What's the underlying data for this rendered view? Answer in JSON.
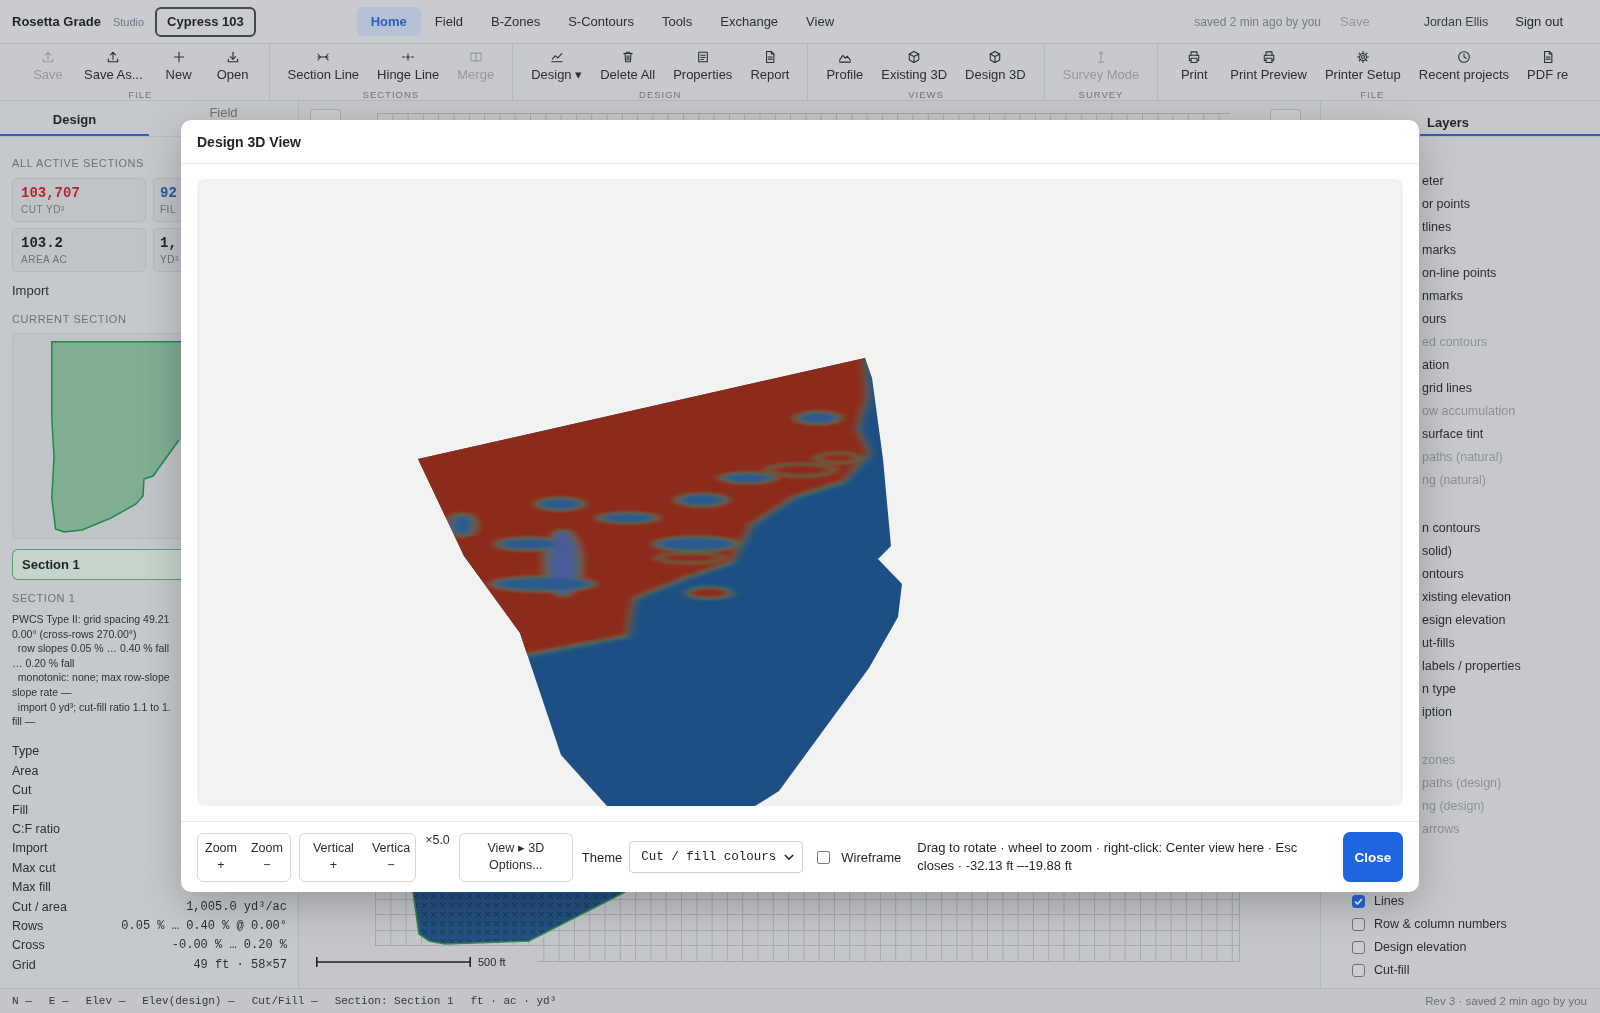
{
  "app": {
    "name": "Rosetta Grade",
    "edition": "Studio",
    "project": "Cypress 103"
  },
  "nav": [
    {
      "label": "Home",
      "selected": true
    },
    {
      "label": "Field",
      "selected": false
    },
    {
      "label": "B-Zones",
      "selected": false
    },
    {
      "label": "S-Contours",
      "selected": false
    },
    {
      "label": "Tools",
      "selected": false
    },
    {
      "label": "Exchange",
      "selected": false
    },
    {
      "label": "View",
      "selected": false
    }
  ],
  "session": {
    "status": "saved 2 min ago by you",
    "save": {
      "label": "Save",
      "disabled": true
    },
    "user": "Jordan Ellis",
    "sign_out": "Sign out"
  },
  "toolbar": [
    {
      "label": "FILE",
      "buttons": [
        {
          "label": "Save",
          "disabled": true
        },
        {
          "label": "Save As...",
          "disabled": false
        },
        {
          "label": "New",
          "disabled": false
        },
        {
          "label": "Open",
          "disabled": false
        }
      ]
    },
    {
      "label": "SECTIONS",
      "buttons": [
        {
          "label": "Section Line",
          "disabled": false
        },
        {
          "label": "Hinge Line",
          "disabled": false
        },
        {
          "label": "Merge",
          "disabled": true
        }
      ]
    },
    {
      "label": "DESIGN",
      "buttons": [
        {
          "label": "Design ▾",
          "disabled": false
        },
        {
          "label": "Delete All",
          "disabled": false
        },
        {
          "label": "Properties",
          "disabled": false
        },
        {
          "label": "Report",
          "disabled": false
        }
      ]
    },
    {
      "label": "VIEWS",
      "buttons": [
        {
          "label": "Profile",
          "disabled": false
        },
        {
          "label": "Existing 3D",
          "disabled": false
        },
        {
          "label": "Design 3D",
          "disabled": false
        }
      ]
    },
    {
      "label": "SURVEY",
      "buttons": [
        {
          "label": "Survey Mode",
          "disabled": true
        }
      ]
    },
    {
      "label": "FILE",
      "buttons": [
        {
          "label": "Print",
          "disabled": false
        },
        {
          "label": "Print Preview",
          "disabled": false
        },
        {
          "label": "Printer Setup",
          "disabled": false
        },
        {
          "label": "Recent projects",
          "disabled": false
        },
        {
          "label": "PDF re",
          "disabled": false
        }
      ]
    }
  ],
  "left_panel": {
    "tabs": [
      {
        "label": "Design",
        "selected": true
      },
      {
        "label": "Field",
        "selected": false
      }
    ],
    "totals_heading": "ALL ACTIVE SECTIONS",
    "totals": [
      {
        "value": "103,707",
        "label": "CUT YD³",
        "color": "#b3262d"
      },
      {
        "value": "92",
        "label": "FIL",
        "color": "#28589a"
      },
      {
        "value": "103.2",
        "label": "AREA AC",
        "color": "#1f2227"
      },
      {
        "value": "1,",
        "label": "YD³",
        "color": "#1f2227"
      }
    ],
    "import": "Import",
    "current_heading": "CURRENT SECTION",
    "sections": [
      {
        "label": "Section 1",
        "selected": true
      }
    ],
    "section_heading": "SECTION 1",
    "description_lines": [
      "PWCS Type II: grid spacing 49.21",
      "0.00° (cross-rows 270.00°)",
      "  row slopes 0.05 % … 0.40 % fall",
      "… 0.20 % fall",
      "  monotonic: none; max row-slope",
      "slope rate —",
      "  import 0 yd³; cut-fill ratio 1.1 to 1.",
      "fill —"
    ],
    "properties": [
      {
        "label": "Type"
      },
      {
        "label": "Area"
      },
      {
        "label": "Cut"
      },
      {
        "label": "Fill"
      },
      {
        "label": "C:F ratio"
      },
      {
        "label": "Import"
      },
      {
        "label": "Max cut"
      },
      {
        "label": "Max fill"
      },
      {
        "label": "Cut / area",
        "value": "1,005.0 yd³/ac"
      },
      {
        "label": "Rows",
        "value": "0.05 % … 0.40 % @ 0.00°"
      },
      {
        "label": "Cross",
        "value": "-0.00 % … 0.20 %"
      },
      {
        "label": "Grid",
        "value": "49 ft · 58×57"
      }
    ]
  },
  "canvas": {
    "scale_label": "500 ft"
  },
  "layers": {
    "tab": {
      "label": "Layers",
      "selected": true
    },
    "groups": [
      {
        "rows": [
          {
            "label": "eter",
            "disabled": false
          },
          {
            "label": "or points",
            "disabled": false
          },
          {
            "label": "tlines",
            "disabled": false
          },
          {
            "label": "marks",
            "disabled": false
          },
          {
            "label": "on-line points",
            "disabled": false
          },
          {
            "label": "nmarks",
            "disabled": false
          },
          {
            "label": "ours",
            "disabled": false
          },
          {
            "label": "ed contours",
            "disabled": true
          },
          {
            "label": "ation",
            "disabled": false
          },
          {
            "label": "grid lines",
            "disabled": false
          },
          {
            "label": "ow accumulation",
            "disabled": true
          },
          {
            "label": "surface tint",
            "disabled": false
          },
          {
            "label": "paths (natural)",
            "disabled": true
          },
          {
            "label": "ng (natural)",
            "disabled": true
          }
        ]
      },
      {
        "rows": [
          {
            "label": "n contours",
            "disabled": false
          },
          {
            "label": "solid)",
            "disabled": false
          },
          {
            "label": "ontours",
            "disabled": false
          },
          {
            "label": "xisting elevation",
            "disabled": false
          },
          {
            "label": "esign elevation",
            "disabled": false
          },
          {
            "label": "ut-fills",
            "disabled": false
          },
          {
            "label": "labels / properties",
            "disabled": false
          },
          {
            "label": "n type",
            "disabled": false
          },
          {
            "label": "iption",
            "disabled": false
          }
        ]
      },
      {
        "rows": [
          {
            "label": "zones",
            "disabled": true
          },
          {
            "label": "paths (design)",
            "disabled": true
          },
          {
            "label": "ng (design)",
            "disabled": true
          },
          {
            "label": "arrows",
            "disabled": true
          }
        ]
      },
      {
        "rows": [
          {
            "label": "Lines",
            "checked": true,
            "disabled": false
          },
          {
            "label": "Row & column numbers",
            "checked": false,
            "disabled": false
          },
          {
            "label": "Design elevation",
            "checked": false,
            "disabled": false
          },
          {
            "label": "Cut-fill",
            "checked": false,
            "disabled": false
          }
        ]
      }
    ]
  },
  "dialog": {
    "title": "Design 3D View",
    "zoom_buttons": [
      "Zoom +",
      "Zoom −"
    ],
    "vertical_buttons": [
      "Vertical +",
      "Vertica −"
    ],
    "exaggeration": "×5.0",
    "options_button": "View ▸ 3D Options...",
    "theme_label": "Theme",
    "theme_value": "Cut / fill colours",
    "wireframe": {
      "label": "Wireframe",
      "checked": false
    },
    "help": "Drag to rotate · wheel to zoom · right-click: Center view here · Esc closes · -32.13 ft –-19.88 ft",
    "close": "Close"
  },
  "status_bar": {
    "items": [
      "N —",
      "E —",
      "Elev —",
      "Elev(design) —",
      "Cut/Fill —",
      "Section: Section 1",
      "ft · ac · yd³"
    ],
    "revision": "Rev 3 · saved 2 min ago by you"
  }
}
